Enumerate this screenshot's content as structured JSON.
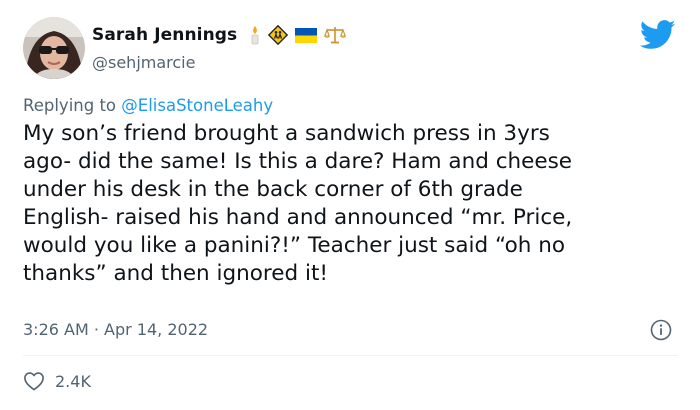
{
  "author": {
    "display_name": "Sarah Jennings",
    "handle": "@sehjmarcie",
    "badges": [
      "candle-icon",
      "school-crossing-sign-icon",
      "ukraine-flag-icon",
      "balance-scale-icon"
    ]
  },
  "reply": {
    "prefix": "Replying to",
    "mention": "@ElisaStoneLeahy"
  },
  "tweet": {
    "lines": [
      "My son’s friend brought a sandwich press in 3yrs",
      "ago- did the same! Is this a dare? Ham and cheese",
      "under his desk in the back corner of 6th grade",
      "English- raised his hand and announced “mr. Price,",
      "would you like a panini?!” Teacher just said “oh no",
      "thanks” and then ignored it!"
    ]
  },
  "meta": {
    "time": "3:26 AM",
    "separator": "·",
    "date": "Apr 14, 2022"
  },
  "stats": {
    "likes": "2.4K"
  },
  "colors": {
    "twitter_blue": "#1d9bf0",
    "secondary_text": "#536471",
    "primary_text": "#0f1419"
  },
  "icons": {
    "logo": "twitter-bird-icon",
    "info": "info-icon",
    "like": "heart-icon"
  }
}
